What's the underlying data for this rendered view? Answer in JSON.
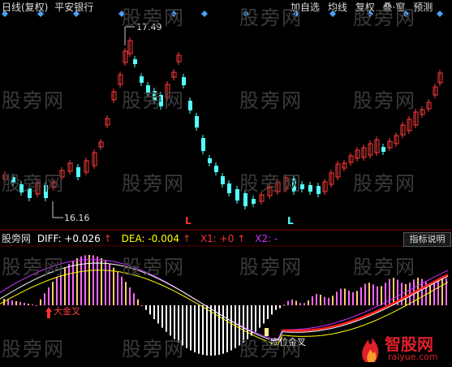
{
  "header": {
    "period_label": "日线(复权)",
    "stock_name": "平安银行",
    "buttons": [
      "加自选",
      "均线",
      "复权",
      "叠·窗",
      "预测"
    ]
  },
  "price_annotations": {
    "high": "17.49",
    "low": "16.16",
    "markers": [
      "L",
      "L"
    ]
  },
  "indicator": {
    "name": "股旁网",
    "diff_label": "DIFF: +0.026",
    "dea_label": "DEA: -0.004",
    "x1_label": "X1: +0",
    "x2_label": "X2: -",
    "explain_button": "指标说明",
    "signal_1": "大金叉",
    "signal_2": "底位金叉"
  },
  "watermark": "股旁网",
  "logo": {
    "title": "智股网",
    "url": "raiyue.com"
  },
  "colors": {
    "up": "#ff3b3b",
    "down": "#54ffff",
    "diff": "#ffffff",
    "dea": "#ffff00",
    "x1": "#ff2020",
    "x2": "#cc33ff",
    "bar_pos_a": "#ff66ff",
    "bar_pos_b": "#ffcc66",
    "bar_neg": "#ffffff"
  }
}
